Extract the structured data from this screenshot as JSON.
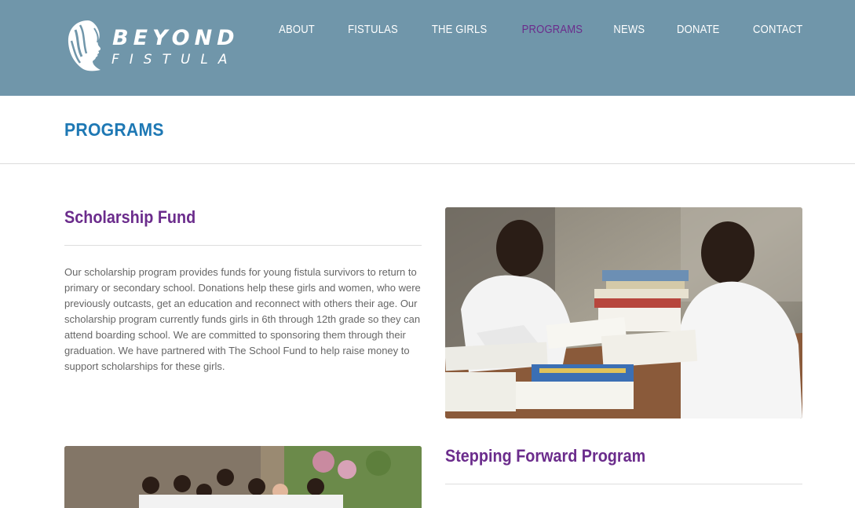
{
  "brand": {
    "line1": "BEYOND",
    "line2": "FISTULA"
  },
  "nav": {
    "items": [
      {
        "label": "ABOUT"
      },
      {
        "label": "FISTULAS"
      },
      {
        "label": "THE GIRLS"
      },
      {
        "label": "PROGRAMS"
      },
      {
        "label": "NEWS"
      },
      {
        "label": "DONATE"
      },
      {
        "label": "CONTACT"
      }
    ],
    "active_index": 3
  },
  "page": {
    "title": "PROGRAMS"
  },
  "sections": [
    {
      "heading": "Scholarship Fund",
      "body": "Our scholarship program provides funds for young fistula survivors to return to primary or secondary school. Donations help these girls and women, who were previously outcasts, get an education and reconnect with others their age. Our scholarship program currently funds girls in 6th through 12th grade so they can attend boarding school. We are committed to sponsoring them through their graduation. We have partnered with The School Fund to help raise money to support scholarships for these girls."
    },
    {
      "heading": "Stepping Forward Program"
    }
  ],
  "colors": {
    "header_bg": "#7096aa",
    "accent_purple": "#6b2c8c",
    "title_blue": "#1e78b4"
  }
}
